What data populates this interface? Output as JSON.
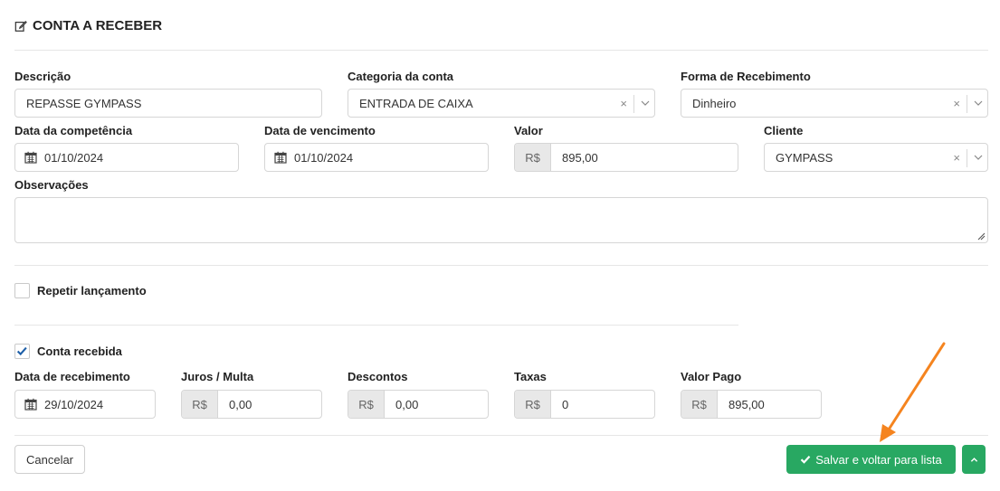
{
  "header": {
    "title": "CONTA A RECEBER"
  },
  "form": {
    "descricao": {
      "label": "Descrição",
      "value": "REPASSE GYMPASS"
    },
    "categoria": {
      "label": "Categoria da conta",
      "value": "ENTRADA DE CAIXA",
      "clear": "×"
    },
    "forma": {
      "label": "Forma de Recebimento",
      "value": "Dinheiro",
      "clear": "×"
    },
    "competencia": {
      "label": "Data da competência",
      "value": "01/10/2024"
    },
    "vencimento": {
      "label": "Data de vencimento",
      "value": "01/10/2024"
    },
    "valor": {
      "label": "Valor",
      "prefix": "R$",
      "value": "895,00"
    },
    "cliente": {
      "label": "Cliente",
      "value": "GYMPASS",
      "clear": "×"
    },
    "observacoes": {
      "label": "Observações",
      "value": ""
    }
  },
  "repetir": {
    "label": "Repetir lançamento",
    "checked": false
  },
  "recebida": {
    "label": "Conta recebida",
    "checked": true,
    "data": {
      "label": "Data de recebimento",
      "value": "29/10/2024"
    },
    "juros": {
      "label": "Juros / Multa",
      "prefix": "R$",
      "value": "0,00"
    },
    "descontos": {
      "label": "Descontos",
      "prefix": "R$",
      "value": "0,00"
    },
    "taxas": {
      "label": "Taxas",
      "prefix": "R$",
      "value": "0"
    },
    "pago": {
      "label": "Valor Pago",
      "prefix": "R$",
      "value": "895,00"
    }
  },
  "actions": {
    "cancel": "Cancelar",
    "save": "Salvar e voltar para lista"
  },
  "colors": {
    "save_green": "#28a862",
    "annotation_arrow": "#f5841f",
    "checkbox_blue": "#1e5fa8"
  },
  "icons": [
    "edit-icon",
    "calendar-icon",
    "check-icon",
    "chevron-down-icon",
    "chevron-up-icon",
    "resize-handle-icon",
    "arrow-annotation"
  ]
}
